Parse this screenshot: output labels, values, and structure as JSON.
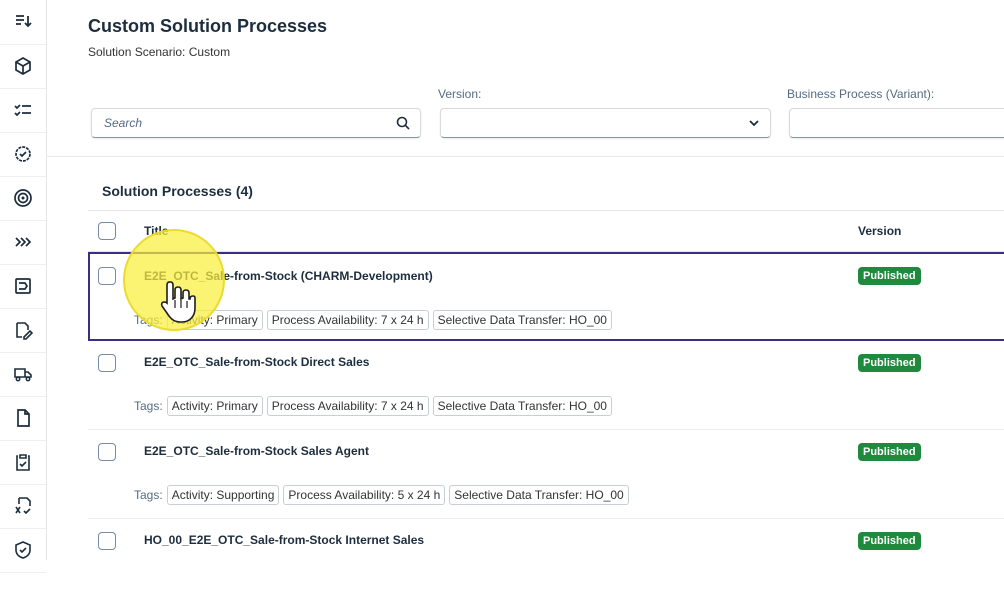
{
  "rail": {
    "icons": [
      "filter-list-icon",
      "cube-icon",
      "checklist-icon",
      "badge-check-icon",
      "target-icon",
      "chevrons-right-icon",
      "process-icon",
      "edit-document-icon",
      "truck-icon",
      "document-icon",
      "clipboard-check-icon",
      "formula-check-icon",
      "shield-check-icon"
    ]
  },
  "header": {
    "title": "Custom Solution Processes",
    "subtitle": "Solution Scenario: Custom"
  },
  "filters": {
    "search_placeholder": "Search",
    "version_label": "Version:",
    "version_value": "",
    "business_process_label": "Business Process (Variant):"
  },
  "table": {
    "section_title": "Solution Processes (4)",
    "col_title": "Title",
    "col_version": "Version",
    "tags_label": "Tags:",
    "rows": [
      {
        "title": "E2E_OTC_Sale-from-Stock (CHARM-Development)",
        "status": "Published",
        "tags": [
          "Activity: Primary",
          "Process Availability: 7 x 24 h",
          "Selective Data Transfer: HO_00"
        ]
      },
      {
        "title": "E2E_OTC_Sale-from-Stock Direct Sales",
        "status": "Published",
        "tags": [
          "Activity: Primary",
          "Process Availability: 7 x 24 h",
          "Selective Data Transfer: HO_00"
        ]
      },
      {
        "title": "E2E_OTC_Sale-from-Stock Sales Agent",
        "status": "Published",
        "tags": [
          "Activity: Supporting",
          "Process Availability: 5 x 24 h",
          "Selective Data Transfer: HO_00"
        ]
      },
      {
        "title": "HO_00_E2E_OTC_Sale-from-Stock Internet Sales",
        "status": "Published",
        "tags": []
      }
    ]
  },
  "colors": {
    "published": "#1f8a3d",
    "selected_border": "#3b2d86",
    "cursor_highlight": "#f5e63c"
  }
}
